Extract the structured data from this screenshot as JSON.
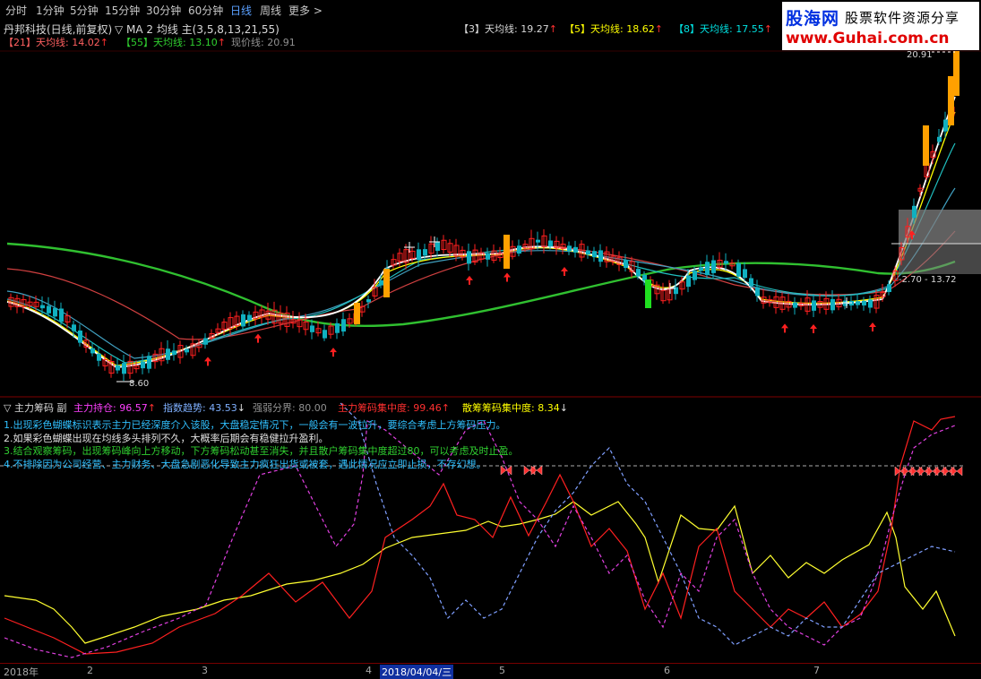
{
  "toolbar": {
    "periods": [
      "分时",
      "1分钟",
      "5分钟",
      "15分钟",
      "30分钟",
      "60分钟",
      "日线",
      "周线"
    ],
    "active": "日线",
    "more": "更多 >"
  },
  "header": {
    "stock": "丹邦科技(日线,前复权)",
    "indicator_title": "▽ MA 2 均线 主(3,5,8,13,21,55)",
    "ma3": "【3】天均线: 19.27",
    "ma5": "【5】天均线: 18.62",
    "ma8": "【8】天均线: 17.55",
    "ma21": "【21】天均线: 14.02",
    "ma55": "【55】天均线: 13.10",
    "current": "现价线: 20.91"
  },
  "price_labels": {
    "high": "20.91",
    "low": "8.60",
    "band": "-2.70 - 13.72"
  },
  "sub_header": {
    "title": "▽ 主力筹码 副",
    "main_holding": "主力持仓: 96.57",
    "index_trend": "指数趋势: 43.53",
    "strength": "强弱分界: 80.00",
    "concentration": "主力筹码集中度: 99.46",
    "retail": "散筹筹码集中度: 8.34"
  },
  "notes": [
    "1.出现彩色蝴蝶标识表示主力已经深度介入该股，大盘稳定情况下，一般会有一波拉升，要综合考虑上方筹码压力。",
    "2.如果彩色蝴蝶出现在均线多头排列不久，大概率后期会有稳健拉升盈利。",
    "3.结合观察筹码，出现筹码峰向上方移动，下方筹码松动甚至消失，并且散户筹码集中度超过80，可以考虑及时止盈。",
    "4.不排除因为公司经营、主力财务、大盘急剧恶化导致主力疯狂出货或被套，遇此情况应立即止损，不存幻想。"
  ],
  "logo": {
    "brand": "股海网",
    "tagline": "股票软件资源分享",
    "url": "www.Guhai.com.cn"
  },
  "x_axis": {
    "labels": [
      "2018年",
      "2",
      "3",
      "4",
      "2018/04/04/三",
      "5",
      "6",
      "7"
    ]
  },
  "colors": {
    "up": "#ff3030",
    "down": "#00c0c0",
    "ma_long": "#30c030",
    "band": "#a0a0a0"
  }
}
